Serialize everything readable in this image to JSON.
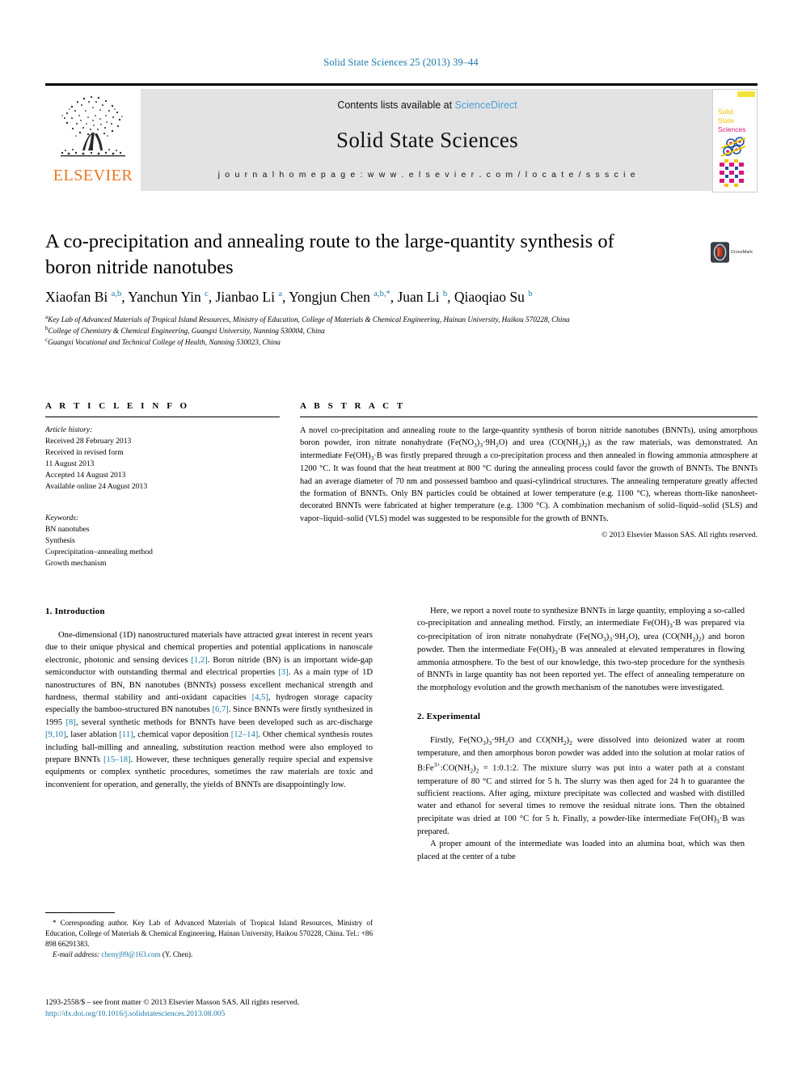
{
  "running_head": "Solid State Sciences 25 (2013) 39–44",
  "masthead": {
    "publisher_logo_text": "ELSEVIER",
    "contents_prefix": "Contents lists available at ",
    "contents_link": "ScienceDirect",
    "journal_name": "Solid State Sciences",
    "homepage_line": "j o u r n a l   h o m e p a g e :   w w w . e l s e v i e r . c o m / l o c a t e / s s s c i e",
    "cover_title_lines": [
      "Solid",
      "State",
      "Sciences"
    ]
  },
  "article": {
    "title": "A co-precipitation and annealing route to the large-quantity synthesis of boron nitride nanotubes",
    "crossmark_label": "CrossMark",
    "authors_html": "Xiaofan Bi <sup>a,b</sup>, Yanchun Yin <sup>c</sup>, Jianbao Li <sup>a</sup>, Yongjun Chen <sup>a,b,</sup><sup>*</sup>, Juan Li <sup>b</sup>, Qiaoqiao Su <sup>b</sup>",
    "affiliations": [
      "Key Lab of Advanced Materials of Tropical Island Resources, Ministry of Education, College of Materials & Chemical Engineering, Hainan University, Haikou 570228, China",
      "College of Chemistry & Chemical Engineering, Guangxi University, Nanning 530004, China",
      "Guangxi Vocational and Technical College of Health, Nanning 530023, China"
    ],
    "affiliation_marks": [
      "a",
      "b",
      "c"
    ]
  },
  "info": {
    "heading": "A R T I C L E   I N F O",
    "history_label": "Article history:",
    "history": [
      "Received 28 February 2013",
      "Received in revised form",
      "11 August 2013",
      "Accepted 14 August 2013",
      "Available online 24 August 2013"
    ],
    "keywords_label": "Keywords:",
    "keywords": [
      "BN nanotubes",
      "Synthesis",
      "Coprecipitation–annealing method",
      "Growth mechanism"
    ]
  },
  "abstract": {
    "heading": "A B S T R A C T",
    "text_html": "A novel co-precipitation and annealing route to the large-quantity synthesis of boron nitride nanotubes (BNNTs), using amorphous boron powder, iron nitrate nonahydrate (Fe(NO<sub>3</sub>)<sub>3</sub>·9H<sub>2</sub>O) and urea (CO(NH<sub>2</sub>)<sub>2</sub>) as the raw materials, was demonstrated. An intermediate Fe(OH)<sub>3</sub>·B was firstly prepared through a co-precipitation process and then annealed in flowing ammonia atmosphere at 1200 °C. It was found that the heat treatment at 800 °C during the annealing process could favor the growth of BNNTs. The BNNTs had an average diameter of 70 nm and possessed bamboo and quasi-cylindrical structures. The annealing temperature greatly affected the formation of BNNTs. Only BN particles could be obtained at lower temperature (e.g. 1100 °C), whereas thorn-like nanosheet-decorated BNNTs were fabricated at higher temperature (e.g. 1300 °C). A combination mechanism of solid–liquid–solid (SLS) and vapor–liquid–solid (VLS) model was suggested to be responsible for the growth of BNNTs.",
    "copyright": "© 2013 Elsevier Masson SAS. All rights reserved."
  },
  "body": {
    "section1_heading": "1.  Introduction",
    "section1_p1_html": "One-dimensional (1D) nanostructured materials have attracted great interest in recent years due to their unique physical and chemical properties and potential applications in nanoscale electronic, photonic and sensing devices <span class=\"cit\">[1,2]</span>. Boron nitride (BN) is an important wide-gap semiconductor with outstanding thermal and electrical properties <span class=\"cit\">[3]</span>. As a main type of 1D nanostructures of BN, BN nanotubes (BNNTs) possess excellent mechanical strength and hardness, thermal stability and anti-oxidant capacities <span class=\"cit\">[4,5]</span>, hydrogen storage capacity especially the bamboo-structured BN nanotubes <span class=\"cit\">[6,7]</span>. Since BNNTs were firstly synthesized in 1995 <span class=\"cit\">[8]</span>, several synthetic methods for BNNTs have been developed such as arc-discharge <span class=\"cit\">[9,10]</span>, laser ablation <span class=\"cit\">[11]</span>, chemical vapor deposition <span class=\"cit\">[12–14]</span>. Other chemical synthesis routes including ball-milling and annealing, substitution reaction method were also employed to prepare BNNTs <span class=\"cit\">[15–18]</span>. However, these techniques generally require special and expensive equipments or complex synthetic procedures, sometimes the raw materials are toxic and inconvenient for operation, and generally, the yields of BNNTs are disappointingly low.",
    "section1_p2_html": "Here, we report a novel route to synthesize BNNTs in large quantity, employing a so-called co-precipitation and annealing method. Firstly, an intermediate Fe(OH)<sub>3</sub>·B was prepared via co-precipitation of iron nitrate nonahydrate (Fe(NO<sub>3</sub>)<sub>3</sub>·9H<sub>2</sub>O), urea (CO(NH<sub>2</sub>)<sub>2</sub>) and boron powder. Then the intermediate Fe(OH)<sub>3</sub>·B was annealed at elevated temperatures in flowing ammonia atmosphere. To the best of our knowledge, this two-step procedure for the synthesis of BNNTs in large quantity has not been reported yet. The effect of annealing temperature on the morphology evolution and the growth mechanism of the nanotubes were investigated.",
    "section2_heading": "2.  Experimental",
    "section2_p1_html": "Firstly, Fe(NO<sub>3</sub>)<sub>3</sub>·9H<sub>2</sub>O and CO(NH<sub>2</sub>)<sub>2</sub> were dissolved into deionized water at room temperature, and then amorphous boron powder was added into the solution at molar ratios of B:Fe<sup class=\"fm\">3+</sup>:CO(NH<sub>2</sub>)<sub>2</sub> = 1:0.1:2. The mixture slurry was put into a water path at a constant temperature of 80 °C and stirred for 5 h. The slurry was then aged for 24 h to guarantee the sufficient reactions. After aging, mixture precipitate was collected and washed with distilled water and ethanol for several times to remove the residual nitrate ions. Then the obtained precipitate was dried at 100 °C for 5 h. Finally, a powder-like intermediate Fe(OH)<sub>3</sub>·B was prepared.",
    "section2_p2_html": "A proper amount of the intermediate was loaded into an alumina boat, which was then placed at the center of a tube"
  },
  "footnote": {
    "corresponding_html": "* Corresponding author. Key Lab of Advanced Materials of Tropical Island Resources, Ministry of Education, College of Materials &amp; Chemical Engineering, Hainan University, Haikou 570228, China. Tel.: +86 898 66291383.",
    "email_label": "E-mail address:",
    "email": "chenyj99@163.com",
    "email_owner": "(Y. Chen)."
  },
  "footer": {
    "issn_line": "1293-2558/$ – see front matter © 2013 Elsevier Masson SAS. All rights reserved.",
    "doi": "http://dx.doi.org/10.1016/j.solidstatesciences.2013.08.005"
  },
  "colors": {
    "link": "#1a7aa8",
    "elsevier_orange": "#E87722",
    "sciencedirect_blue": "#4a9fd4",
    "panel_grey": "#e3e3e3"
  }
}
